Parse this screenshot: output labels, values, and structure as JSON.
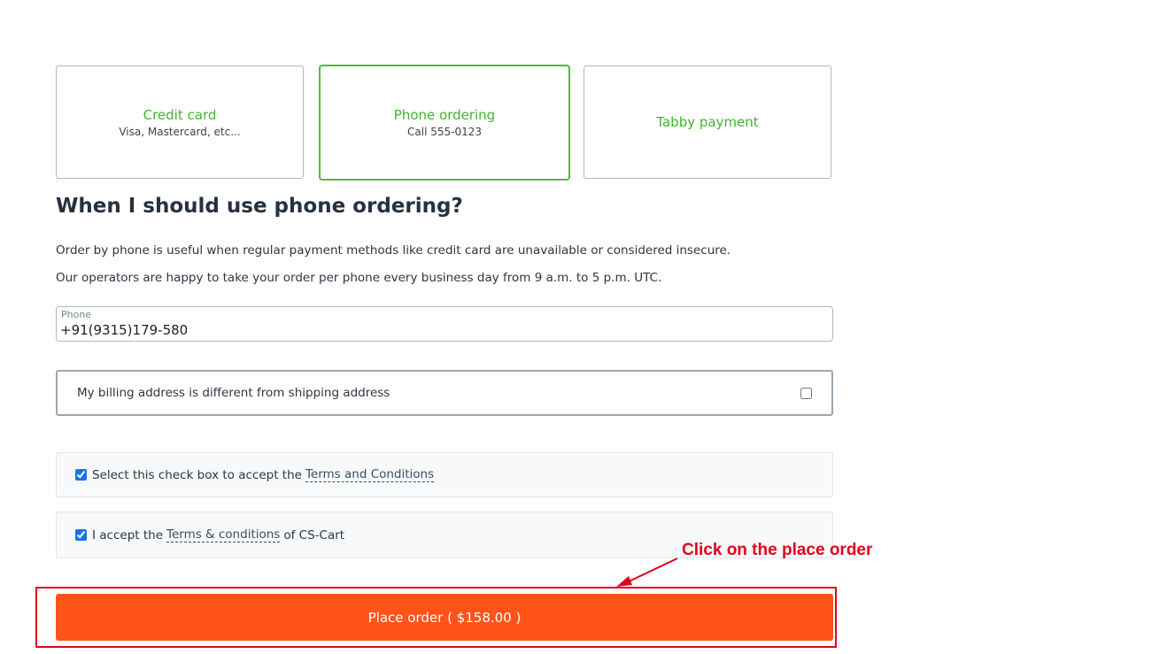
{
  "payment_methods": [
    {
      "title": "Credit card",
      "subtitle": "Visa, Mastercard, etc..."
    },
    {
      "title": "Phone ordering",
      "subtitle": "Call 555-0123",
      "selected": true
    },
    {
      "title": "Tabby payment",
      "subtitle": ""
    }
  ],
  "info": {
    "heading": "When I should use phone ordering?",
    "paragraph1": "Order by phone is useful when regular payment methods like credit card are unavailable or considered insecure.",
    "paragraph2": "Our operators are happy to take your order per phone every business day from 9 a.m. to 5 p.m. UTC."
  },
  "phone": {
    "label": "Phone",
    "value": "+91(9315)179-580"
  },
  "billing": {
    "label": "My billing address is different from shipping address",
    "checked": false
  },
  "terms1": {
    "prefix": "Select this check box to accept the",
    "link": "Terms and Conditions",
    "suffix": "",
    "checked": true
  },
  "terms2": {
    "prefix": "I accept the",
    "link": "Terms & conditions",
    "suffix": "of CS-Cart",
    "checked": true
  },
  "place_order": {
    "label": "Place order ( $158.00 )"
  },
  "annotation": {
    "text": "Click on the place order"
  },
  "colors": {
    "accent_green": "#3fb62c",
    "button_orange": "#ff5319",
    "annotation_red": "#e3001b"
  }
}
